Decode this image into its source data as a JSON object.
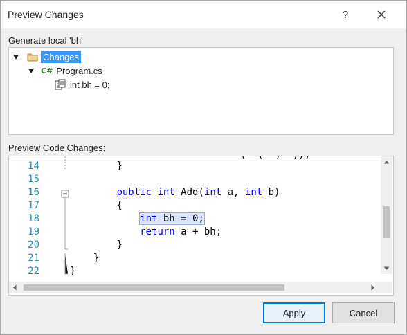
{
  "window": {
    "title": "Preview Changes",
    "help": "?"
  },
  "tree_section": {
    "label": "Generate local 'bh'",
    "items": [
      {
        "label": "Changes",
        "icon": "folder-icon",
        "selected": true
      },
      {
        "label": "Program.cs",
        "icon": "csharp-file-icon"
      },
      {
        "label": "int bh = 0;",
        "icon": "code-change-icon"
      }
    ]
  },
  "code_section": {
    "label": "Preview Code Changes:",
    "lines": [
      {
        "num": "14",
        "text": "        }"
      },
      {
        "num": "15",
        "text": ""
      },
      {
        "num": "16",
        "text": "        public int Add(int a, int b)"
      },
      {
        "num": "17",
        "text": "        {"
      },
      {
        "num": "18",
        "text": "            int bh = 0;"
      },
      {
        "num": "19",
        "text": "            return a + bh;"
      },
      {
        "num": "20",
        "text": "        }"
      },
      {
        "num": "21",
        "text": "    }"
      },
      {
        "num": "22",
        "text": "}"
      }
    ]
  },
  "buttons": {
    "apply": "Apply",
    "cancel": "Cancel"
  },
  "colors": {
    "selection": "#3399ff",
    "line_numbers": "#2b91af",
    "keyword": "#0000ff",
    "highlight": "#dbe5ff"
  }
}
